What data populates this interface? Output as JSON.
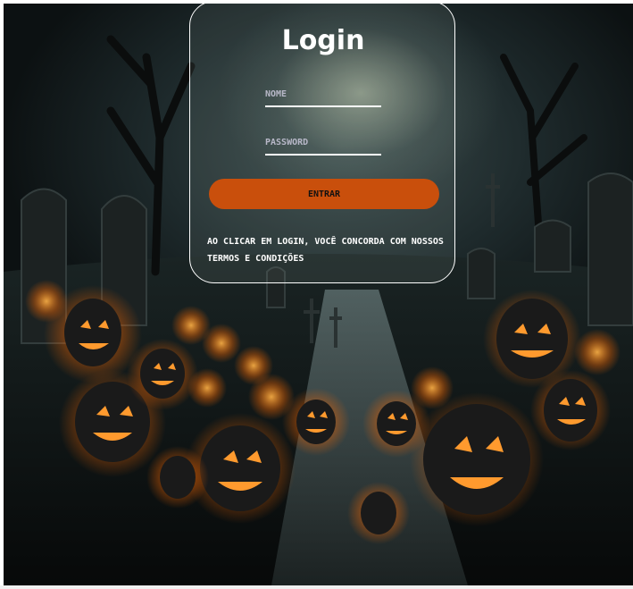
{
  "login": {
    "title": "Login",
    "name_placeholder": "NOME",
    "password_placeholder": "PASSWORD",
    "submit_label": "ENTRAR",
    "terms_text": "AO CLICAR EM LOGIN, VOCÊ CONCORDA COM NOSSOS TERMOS E CONDIÇÕES"
  },
  "colors": {
    "accent": "#c94f0c",
    "card_border": "#ffffff",
    "text": "#ffffff"
  },
  "background": {
    "description_icon": "halloween-graveyard-pumpkins-image"
  }
}
